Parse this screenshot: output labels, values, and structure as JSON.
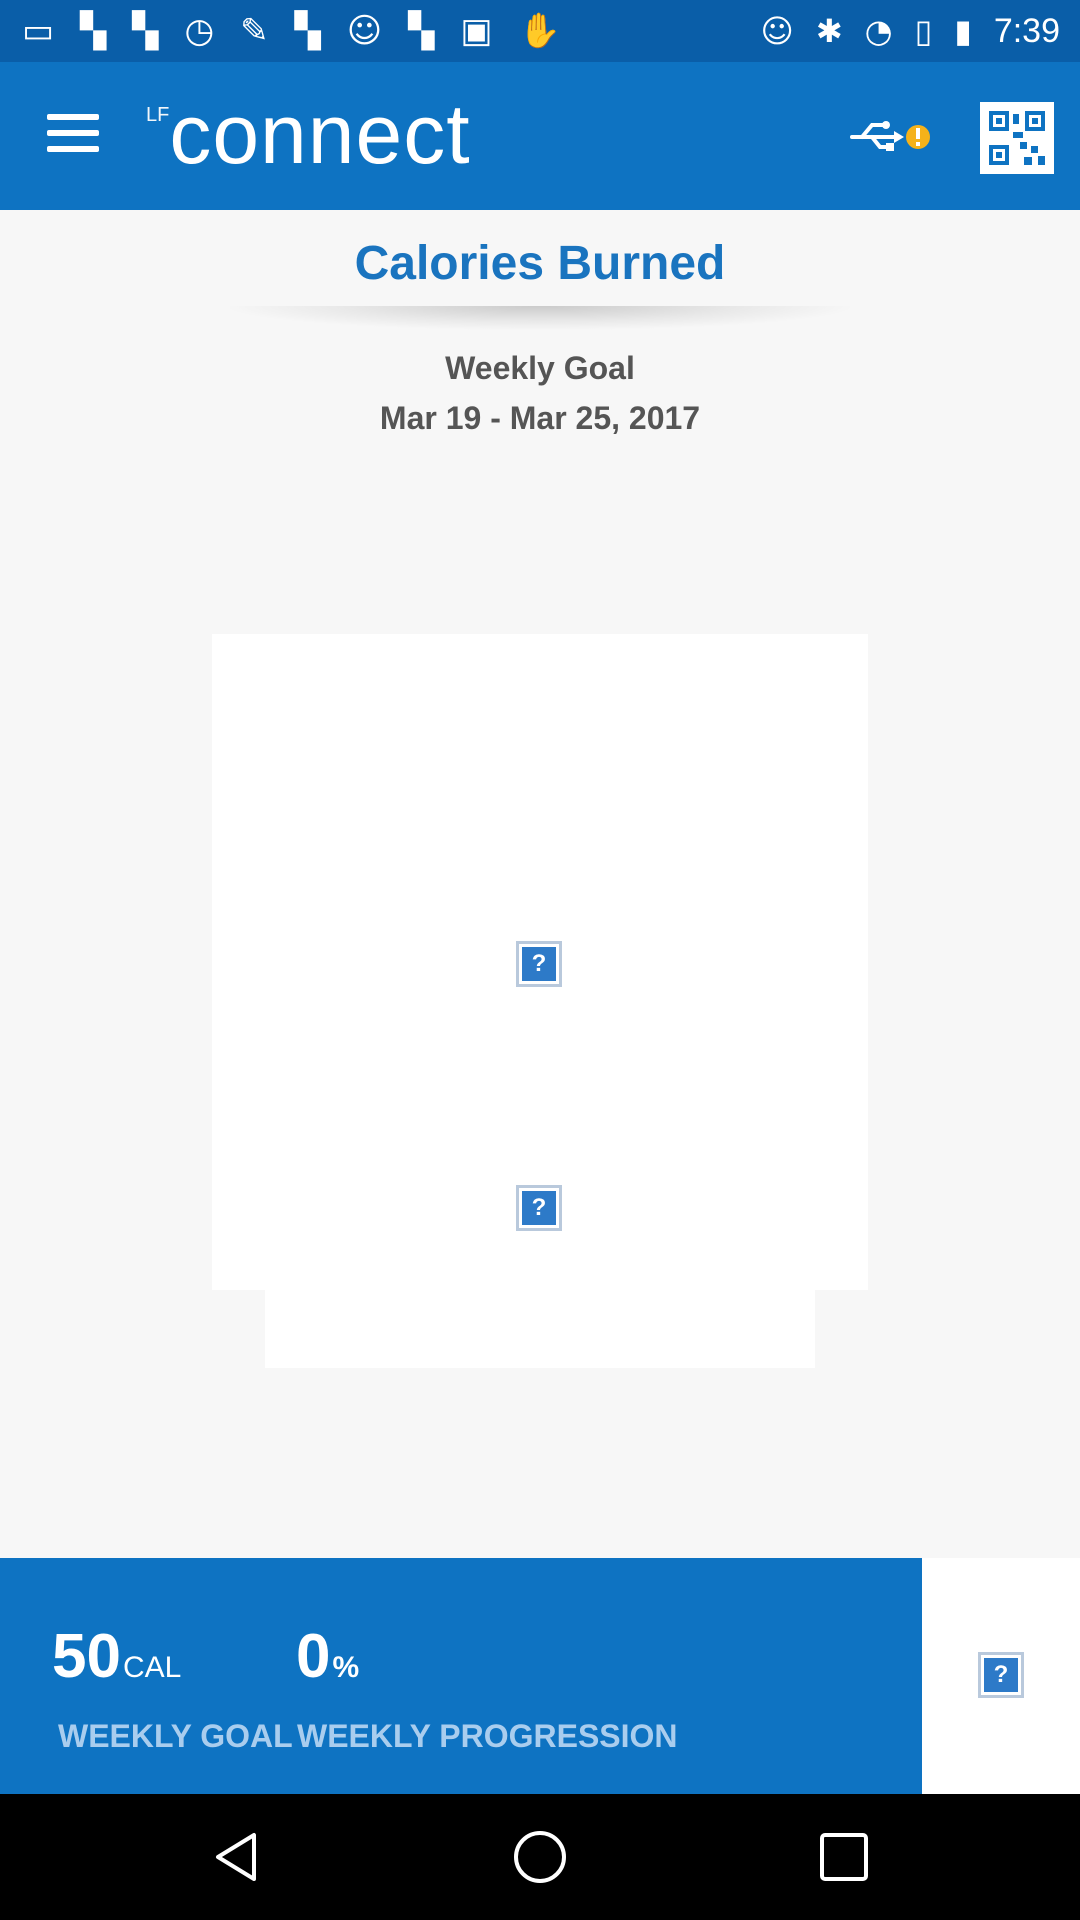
{
  "status_bar": {
    "time": "7:39",
    "icons": [
      "message-icon",
      "flipboard-icon",
      "flipboard-icon",
      "timer-icon",
      "wrench-icon",
      "flipboard-icon",
      "smiley-icon",
      "flipboard-icon",
      "qt-icon",
      "gesture-icon",
      "smiley-icon",
      "bluetooth-icon",
      "alarm-icon",
      "vibrate-icon",
      "battery-icon"
    ]
  },
  "app_bar": {
    "logo_prefix": "LF",
    "logo_text": "connect"
  },
  "header": {
    "title": "Calories Burned",
    "subtitle": "Weekly Goal",
    "date_range": "Mar 19 - Mar 25, 2017"
  },
  "summary": {
    "goal_value": "50",
    "goal_unit": "CAL",
    "goal_label": "WEEKLY GOAL",
    "progress_value": "0",
    "progress_unit": "%",
    "progress_label": "WEEKLY PROGRESSION"
  },
  "broken_image_glyph": "?",
  "colors": {
    "primary": "#0e73c2",
    "status_bar": "#0a5ea8",
    "title": "#1a74bf",
    "label": "#a9cdee",
    "warning": "#f5b21a"
  }
}
